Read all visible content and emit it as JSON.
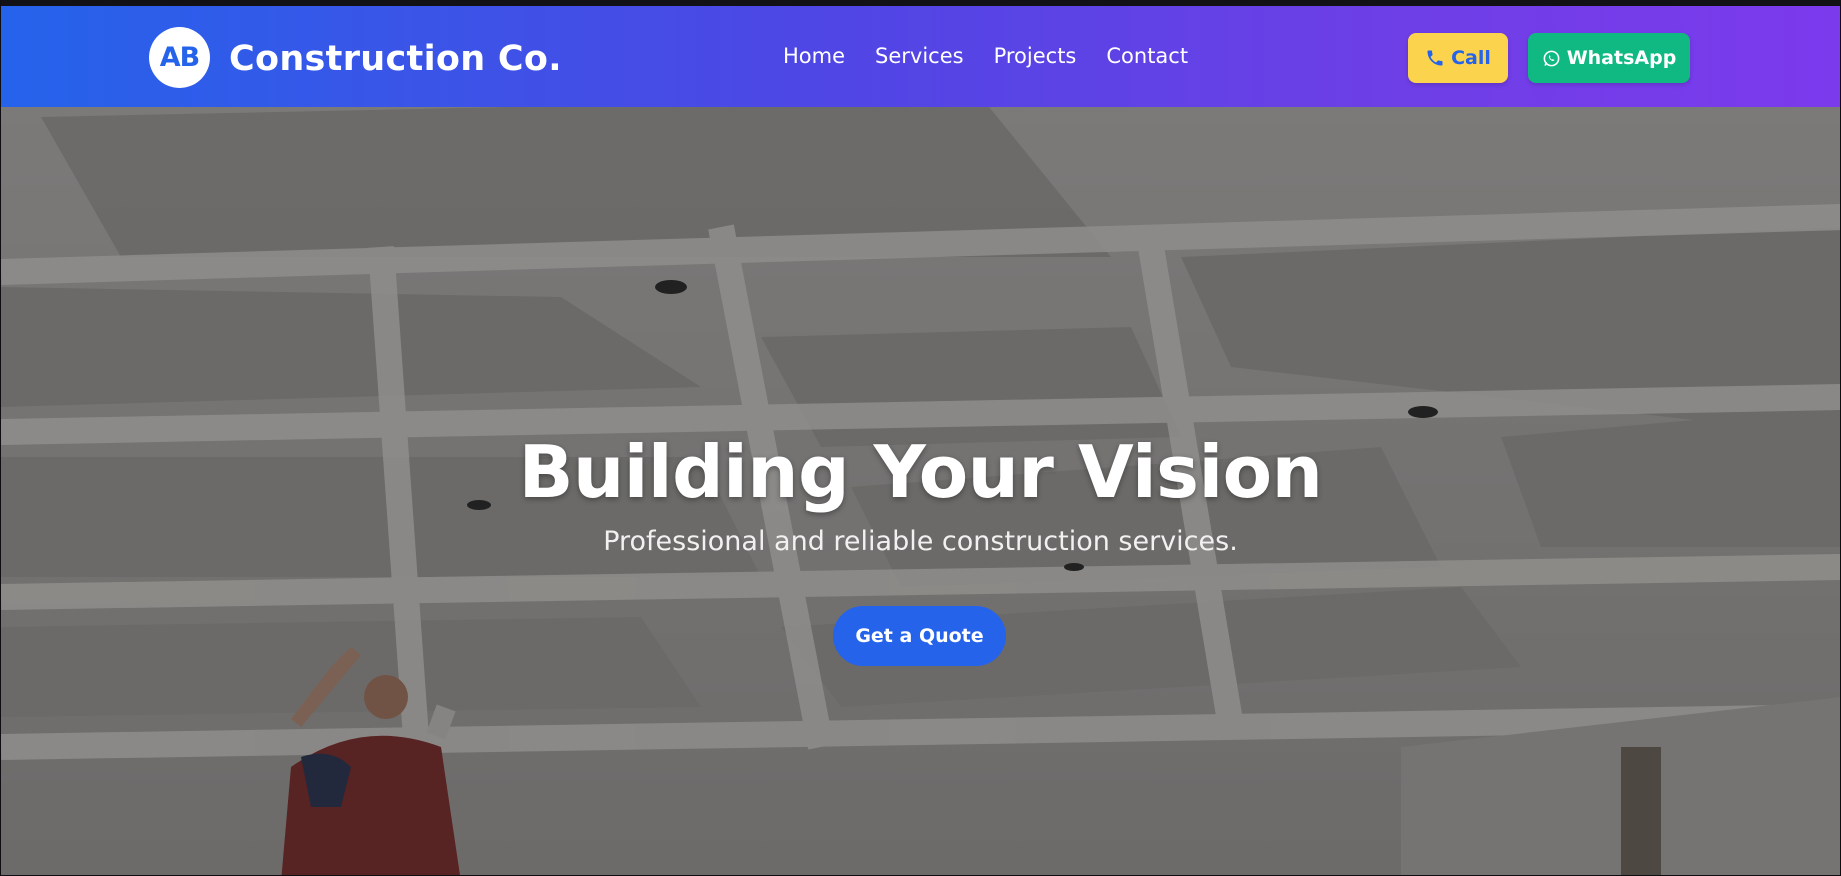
{
  "header": {
    "logo_initials": "AB",
    "brand": "Construction Co.",
    "nav": [
      "Home",
      "Services",
      "Projects",
      "Contact"
    ],
    "call_label": "Call",
    "whatsapp_label": "WhatsApp"
  },
  "hero": {
    "title": "Building Your Vision",
    "subtitle": "Professional and reliable construction services.",
    "cta_label": "Get a Quote"
  },
  "colors": {
    "header_gradient_start": "#2563eb",
    "header_gradient_end": "#7c3aed",
    "call_button": "#fcd34d",
    "whatsapp_button": "#10b981",
    "cta_button": "#2563eb"
  },
  "icons": {
    "call": "phone-icon",
    "whatsapp": "whatsapp-icon"
  }
}
